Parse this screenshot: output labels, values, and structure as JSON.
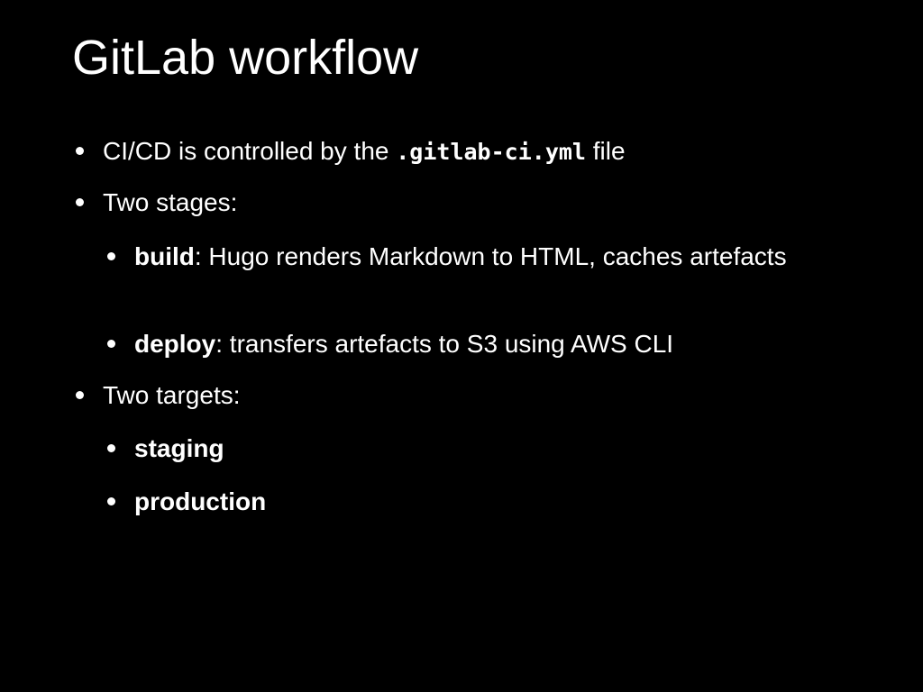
{
  "slide": {
    "title": "GitLab workflow",
    "bullets": [
      {
        "pre": "CI/CD is controlled  by the ",
        "code": ".gitlab-ci.yml",
        "post": " file"
      },
      {
        "text": "Two stages:",
        "children": [
          {
            "bold": "build",
            "rest": ": Hugo renders Markdown to HTML, caches artefacts"
          },
          {
            "bold": "deploy",
            "rest": ": transfers artefacts to S3 using AWS CLI"
          }
        ]
      },
      {
        "text": "Two targets:",
        "children": [
          {
            "bold": "staging",
            "rest": ""
          },
          {
            "bold": "production",
            "rest": ""
          }
        ]
      }
    ]
  },
  "colors": {
    "background": "#000000",
    "text": "#ffffff"
  }
}
